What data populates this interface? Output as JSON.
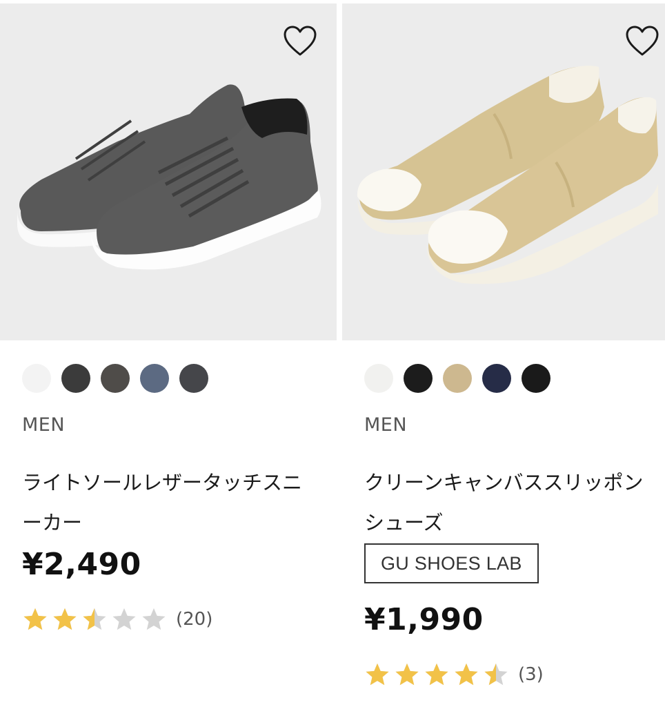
{
  "products": [
    {
      "gender": "MEN",
      "name": "ライトソールレザータッチスニーカー",
      "tag": "",
      "price": "¥2,490",
      "rating": 2.5,
      "review_count": "(20)",
      "swatches": [
        "#f3f3f3",
        "#3b3b3b",
        "#4f4c49",
        "#5c6a82",
        "#45464a"
      ],
      "shoe": "gray leather sneaker"
    },
    {
      "gender": "MEN",
      "name": "クリーンキャンバススリッポンシューズ",
      "tag": "GU SHOES LAB",
      "price": "¥1,990",
      "rating": 4.5,
      "review_count": "(3)",
      "swatches": [
        "#f1f1ef",
        "#1c1c1c",
        "#cdb88f",
        "#262c47",
        "#1a1a1a"
      ],
      "shoe": "beige canvas slip-on"
    }
  ],
  "colors": {
    "star_filled": "#f2c248",
    "star_empty": "#d3d3d3",
    "image_bg": "#ececec"
  },
  "icons": {
    "favorite": "heart-outline-icon",
    "rating": "star-icon"
  }
}
